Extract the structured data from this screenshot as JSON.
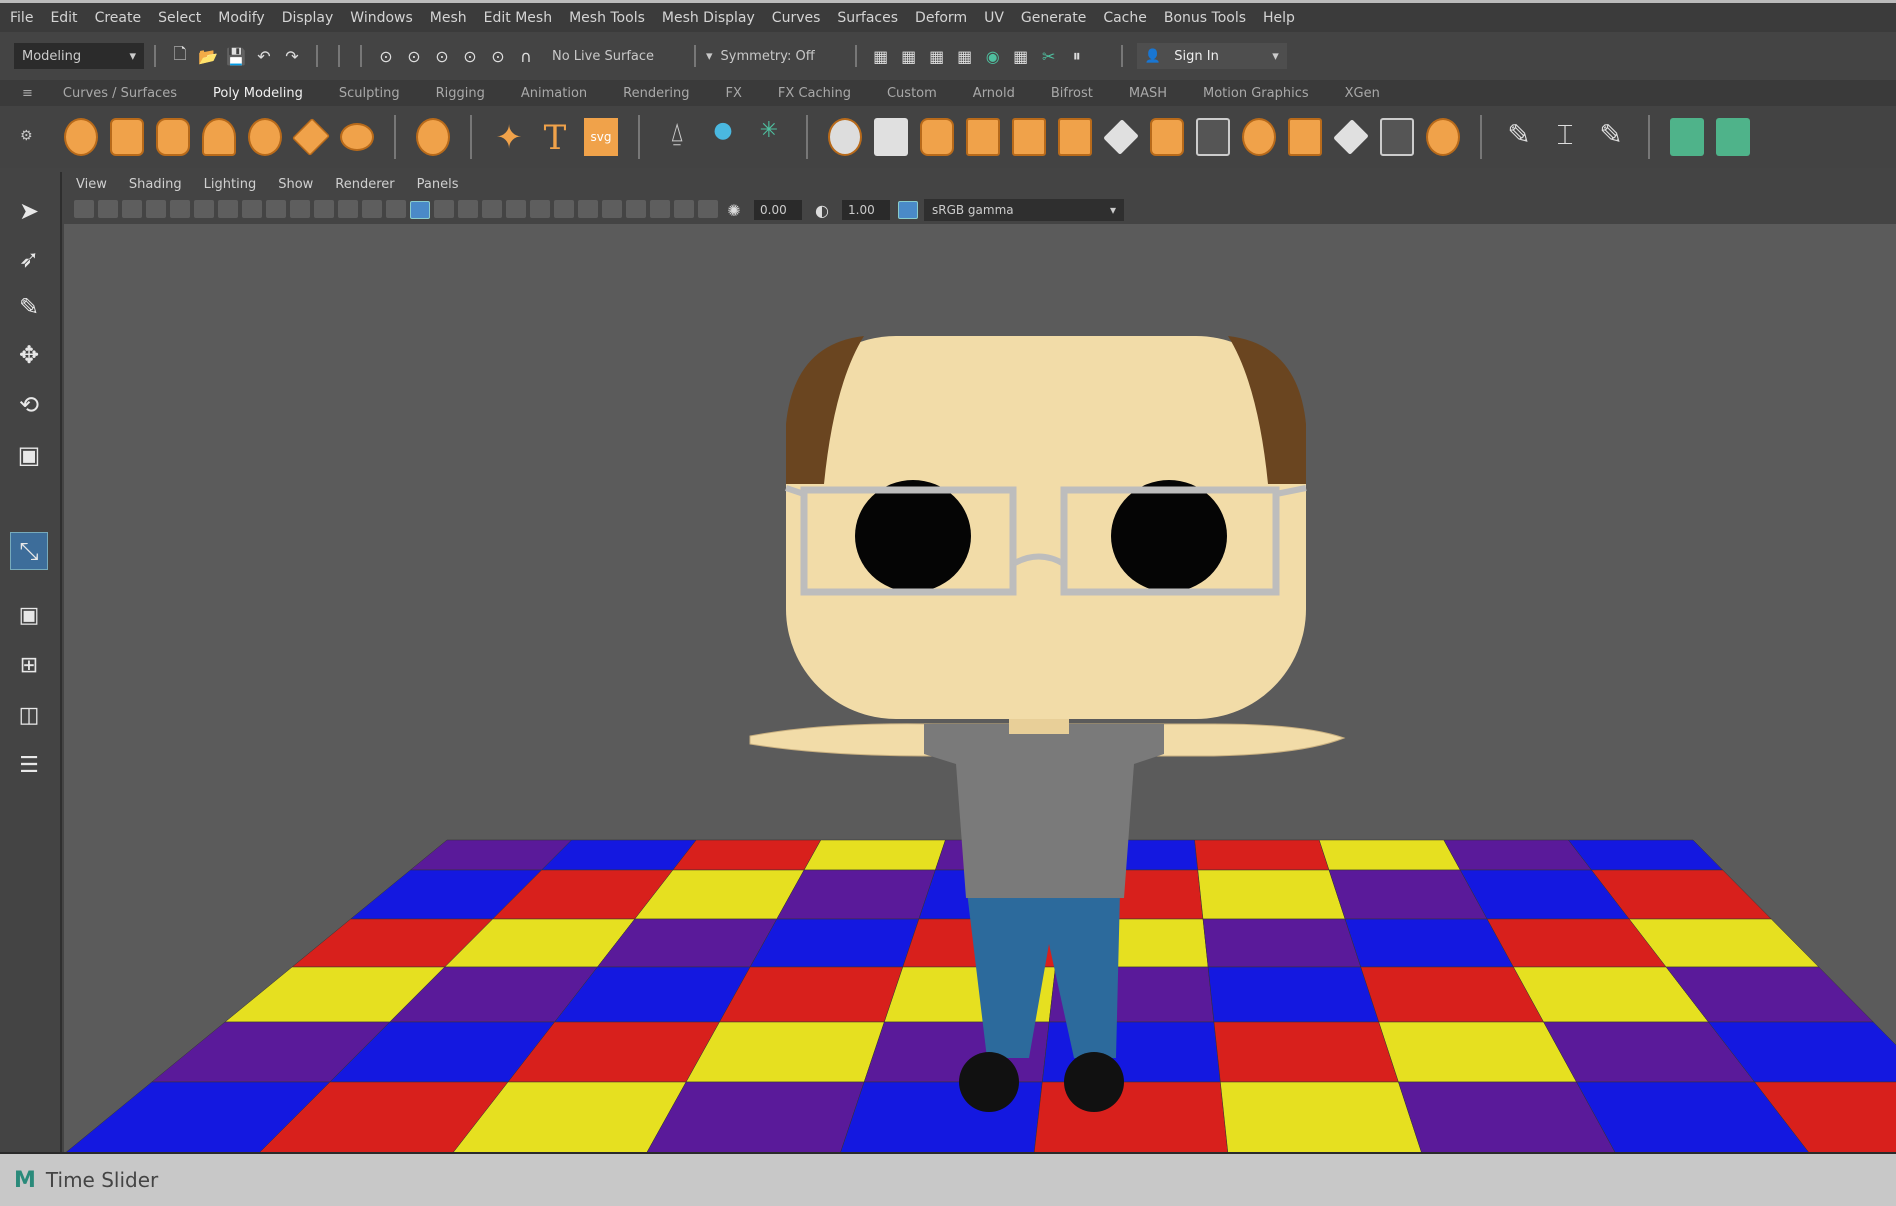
{
  "menubar": {
    "items": [
      "File",
      "Edit",
      "Create",
      "Select",
      "Modify",
      "Display",
      "Windows",
      "Mesh",
      "Edit Mesh",
      "Mesh Tools",
      "Mesh Display",
      "Curves",
      "Surfaces",
      "Deform",
      "UV",
      "Generate",
      "Cache",
      "Bonus Tools",
      "Help"
    ]
  },
  "statusline": {
    "workspace": "Modeling",
    "live_surface": "No Live Surface",
    "symmetry": "Symmetry: Off",
    "sign_in": "Sign In"
  },
  "shelf": {
    "tabs": [
      "Curves / Surfaces",
      "Poly Modeling",
      "Sculpting",
      "Rigging",
      "Animation",
      "Rendering",
      "FX",
      "FX Caching",
      "Custom",
      "Arnold",
      "Bifrost",
      "MASH",
      "Motion Graphics",
      "XGen"
    ],
    "active_tab": "Poly Modeling",
    "svg_label": "svg",
    "text_label": "T"
  },
  "viewport": {
    "menu": [
      "View",
      "Shading",
      "Lighting",
      "Show",
      "Renderer",
      "Panels"
    ],
    "exposure": "0.00",
    "gamma": "1.00",
    "color_space": "sRGB gamma"
  },
  "scene": {
    "floor_colors": [
      "#5a1a9a",
      "#1418e0",
      "#d8201c",
      "#e6e020"
    ],
    "skin": "#f2dca8",
    "shirt": "#7a7a7a",
    "jeans": "#2c6a9c",
    "hair": "#6a4520"
  },
  "timeslider": {
    "label": "Time Slider"
  }
}
